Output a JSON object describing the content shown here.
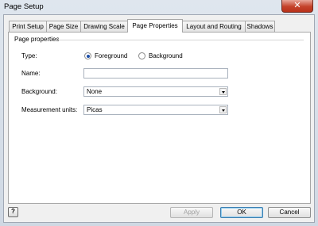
{
  "window": {
    "title": "Page Setup",
    "close_glyph": "✕"
  },
  "tabs": [
    {
      "label": "Print Setup"
    },
    {
      "label": "Page Size"
    },
    {
      "label": "Drawing Scale"
    },
    {
      "label": "Page Properties"
    },
    {
      "label": "Layout and Routing"
    },
    {
      "label": "Shadows"
    }
  ],
  "active_tab": "Page Properties",
  "group": {
    "label": "Page properties"
  },
  "form": {
    "type_label": "Type:",
    "foreground_label": "Foreground",
    "background_label": "Background",
    "type_selected": "Foreground",
    "name_label": "Name:",
    "name_value": "",
    "background_field_label": "Background:",
    "background_value": "None",
    "units_label": "Measurement units:",
    "units_value": "Picas"
  },
  "buttons": {
    "help": "?",
    "apply": "Apply",
    "ok": "OK",
    "cancel": "Cancel"
  }
}
